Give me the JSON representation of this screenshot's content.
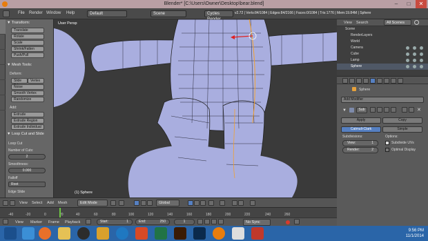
{
  "window": {
    "title": "Blender* [C:\\Users\\Owner\\Desktop\\bear.blend]",
    "minimize": "–",
    "maximize": "□",
    "close": "✕"
  },
  "info_header": {
    "menus": [
      "File",
      "Render",
      "Window",
      "Help"
    ],
    "layout": "Default",
    "scene": "Scene",
    "engine": "Cycles Render",
    "stats": "v2.72 | Verts:84/1084 | Edges:84/2166 | Faces:0/1084 | Tris:1776 | Mem:19.84M | Sphere"
  },
  "toolshelf": {
    "transform_header": "▼ Transform:",
    "transform_buttons": [
      "Translate",
      "Rotate",
      "Scale",
      "Shrink/Fatten",
      "Push/Pull"
    ],
    "mesh_tools_header": "▼ Mesh Tools:",
    "deform_label": "Deform:",
    "slide_edge": "Slide Edge",
    "vertex": "Vertex",
    "noise": "Noise",
    "smooth_vertex": "Smooth Vertex",
    "randomize": "Randomize",
    "add_label": "Add:",
    "extrude": "Extrude",
    "extrude_region": "Extrude Region",
    "extrude_individual": "Extrude Individual",
    "loop_header": "▼ Loop Cut and Slide",
    "loop_cut_label": "Loop Cut",
    "num_cuts_label": "Number of Cuts:",
    "num_cuts_value": "2",
    "smoothness_label": "Smoothness:",
    "smoothness_value": "0.000",
    "falloff_label": "Falloff",
    "falloff_value": "Root",
    "edge_slide_label": "Edge Slide"
  },
  "viewport": {
    "label": "User Persp",
    "object_label": "(1) Sphere"
  },
  "view3d_header": {
    "menus": [
      "View",
      "Select",
      "Add",
      "Mesh"
    ],
    "mode": "Edit Mode",
    "orientation": "Global"
  },
  "timeline": {
    "ticks": [
      "-40",
      "-20",
      "0",
      "20",
      "40",
      "60",
      "80",
      "100",
      "120",
      "140",
      "160",
      "180",
      "200",
      "220",
      "240",
      "260"
    ],
    "menus": [
      "View",
      "Marker",
      "Frame",
      "Playback"
    ],
    "start_label": "Start:",
    "start_value": "1",
    "end_label": "End:",
    "end_value": "250",
    "current_frame": "1",
    "sync": "No Sync"
  },
  "outliner": {
    "view_menu": "View",
    "search_menu": "Search",
    "filter": "All Scenes",
    "items": [
      "Scene",
      "RenderLayers",
      "World",
      "Camera",
      "Cube",
      "Lamp",
      "Sphere"
    ]
  },
  "properties": {
    "object_name": "Sphere",
    "add_modifier": "Add Modifier",
    "modifier_name": "Sub",
    "apply": "Apply",
    "copy": "Copy",
    "catmull_clark": "Catmull-Clark",
    "simple": "Simple",
    "subdivisions_label": "Subdivisions:",
    "view_label": "View:",
    "view_value": "1",
    "render_label": "Render:",
    "render_value": "2",
    "options_label": "Options:",
    "subdivide_uvs": "Subdivide UVs",
    "optimal_display": "Optimal Display"
  },
  "taskbar": {
    "time": "9:56 PM",
    "date": "11/1/2014"
  },
  "colors": {
    "titlebar": "#b99fa4",
    "taskbar": "#2a65a8",
    "mesh": "#a9aedf",
    "active_toggle": "#5680c2"
  }
}
